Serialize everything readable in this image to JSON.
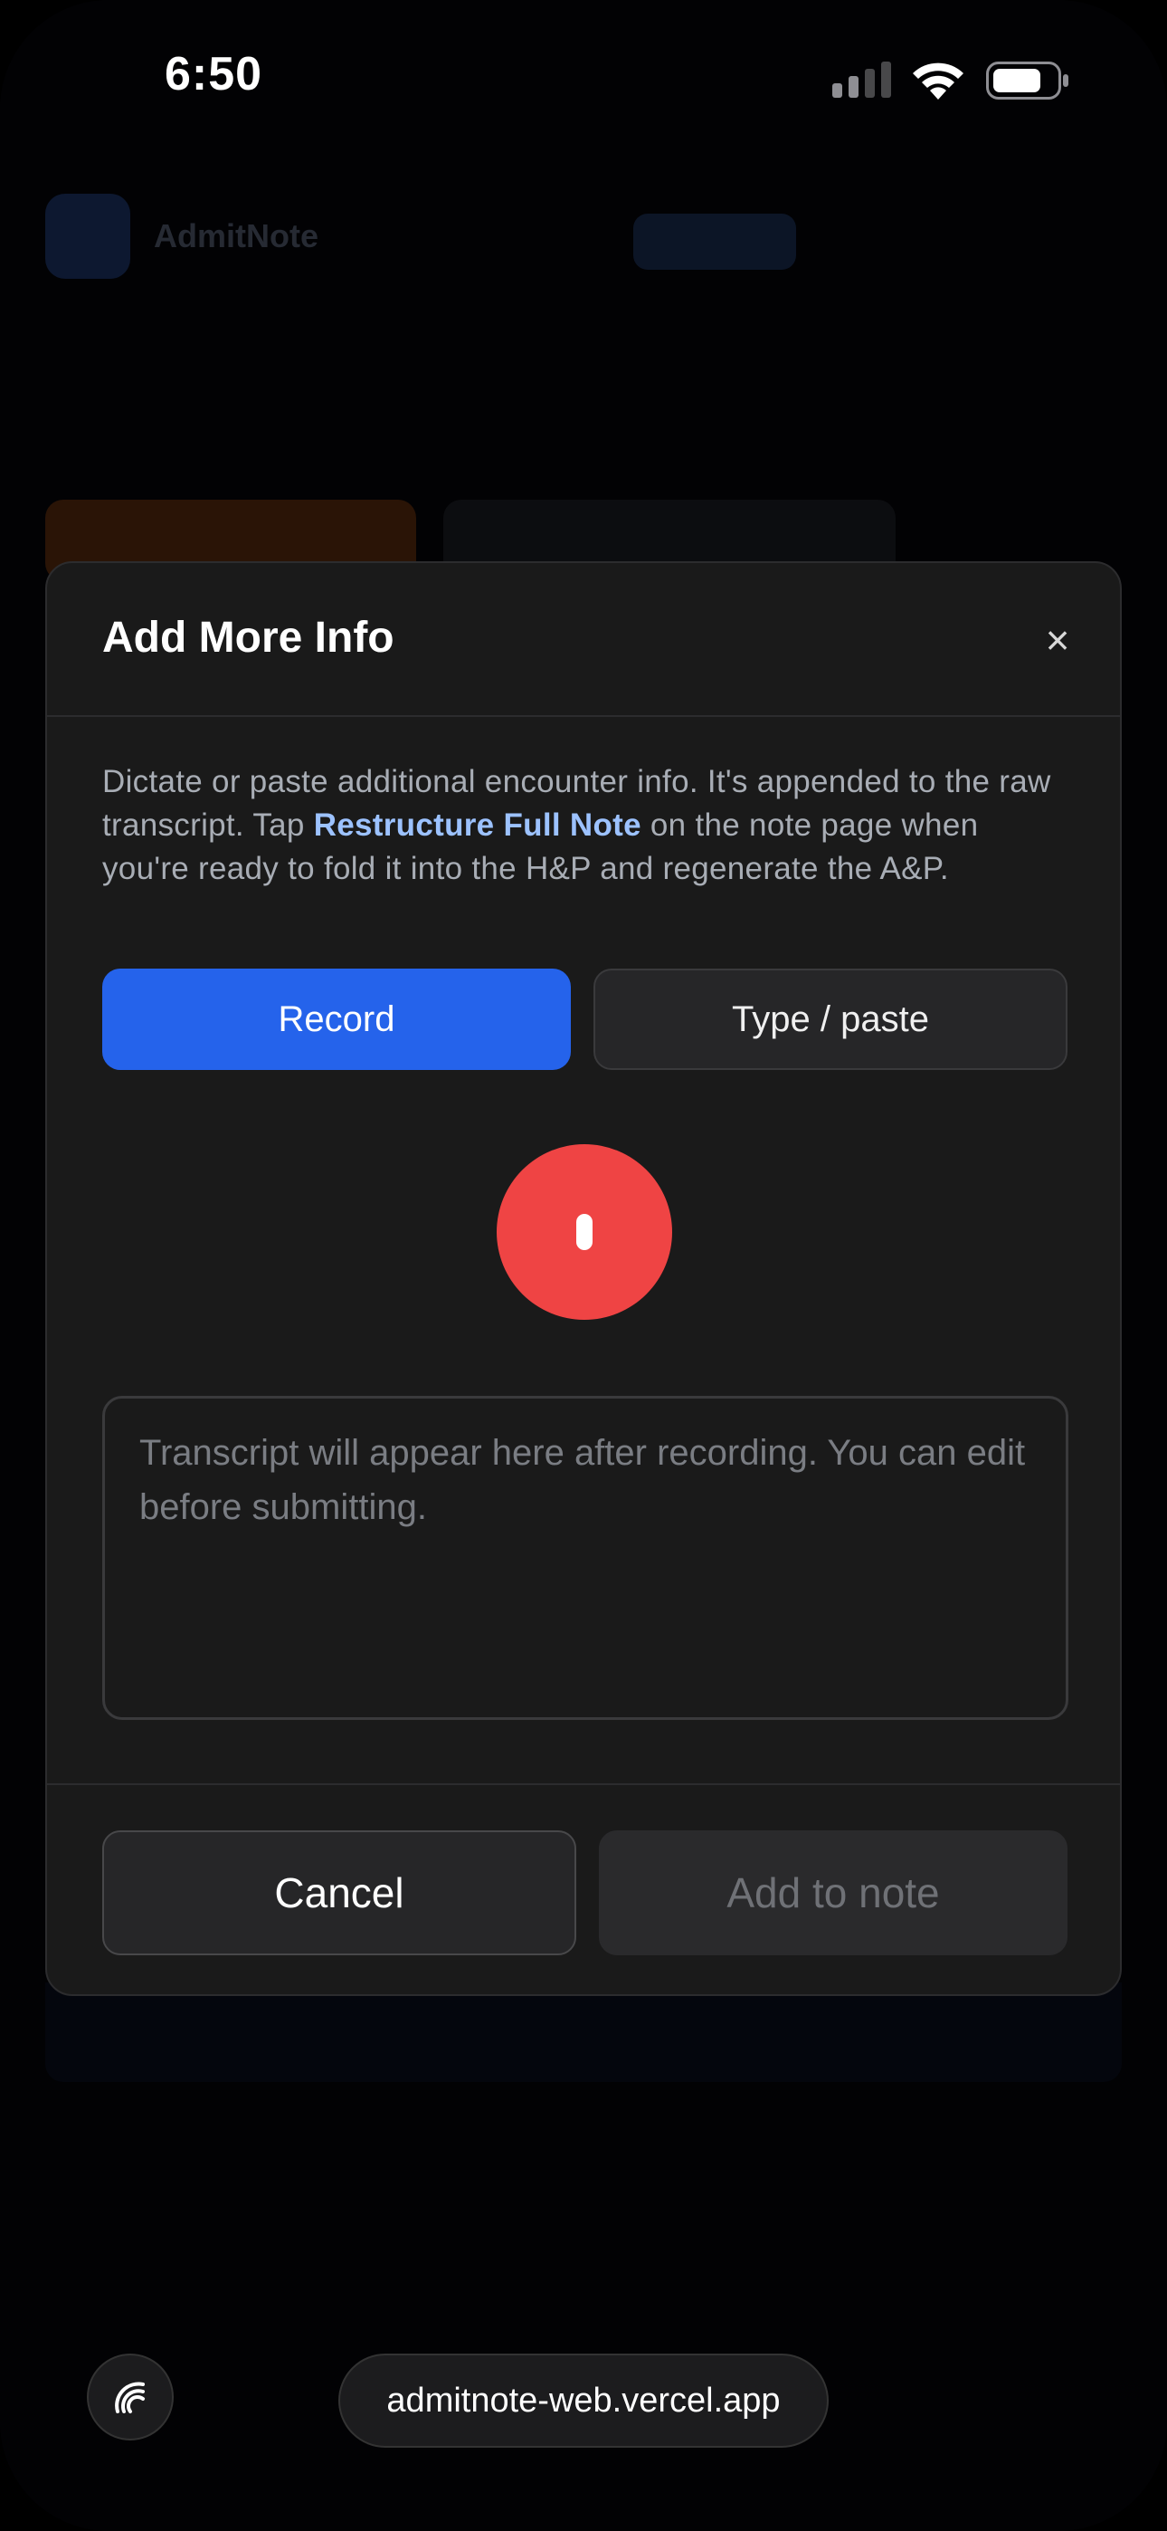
{
  "status_bar": {
    "time": "6:50",
    "icons": [
      "cellular-signal-icon",
      "wifi-icon",
      "battery-icon"
    ]
  },
  "background_page": {
    "app_name": "AdmitNote"
  },
  "modal": {
    "title": "Add More Info",
    "close_icon": "×",
    "description": {
      "before": "Dictate or paste additional encounter info. It's appended to the raw transcript. Tap ",
      "highlight": "Restructure Full Note",
      "after": " on the note page when you're ready to fold it into the H&P and regenerate the A&P."
    },
    "modes": {
      "record_label": "Record",
      "type_label": "Type / paste",
      "selected": "Record"
    },
    "transcript": {
      "value": "",
      "placeholder": "Transcript will appear here after recording. You can edit before submitting."
    },
    "footer": {
      "cancel_label": "Cancel",
      "add_label": "Add to note"
    }
  },
  "browser": {
    "url": "admitnote-web.vercel.app"
  },
  "colors": {
    "accent_blue": "#2563eb",
    "record_red": "#ef4444",
    "link_highlight": "#9cc2ff",
    "modal_bg": "#1a1a1a"
  }
}
